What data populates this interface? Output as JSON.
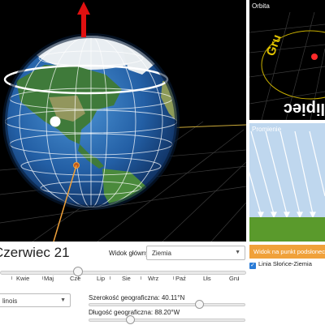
{
  "panels": {
    "orbit_title": "Orbita",
    "orbit_glyphs": [
      "Gru",
      "lipiec"
    ],
    "rays_title": "Promienie"
  },
  "controls": {
    "date_title": "Czerwiec 21",
    "view_label": "Widok główny:",
    "view_value": "Ziemia",
    "subsolar_button": "Widok na punkt podsłoneczny",
    "sun_earth_line_label": "Linia Słońce-Ziemia",
    "sun_earth_line_checked": true,
    "months": [
      "Kwie",
      "Maj",
      "Cze",
      "Lip",
      "Sie",
      "Wrz",
      "Paź",
      "Lis",
      "Gru"
    ],
    "month_slider_fraction": 0.31,
    "place_value": "linois",
    "latitude_label": "Szerokość geograficzna: 40.11°N",
    "longitude_label": "Długość geograficzna: 88.20°W",
    "latitude_fraction": 0.72,
    "longitude_fraction": 0.25
  },
  "colors": {
    "space": "#000000",
    "ocean": "#1f5fa8",
    "land": "#3f7a3a",
    "desert": "#b7a36c",
    "ice": "#e9eef2",
    "axis_arrow": "#e01010",
    "accent_orange": "#f0a13a",
    "ray_sky": "#bfd7ee",
    "ground": "#5a9a2c"
  }
}
